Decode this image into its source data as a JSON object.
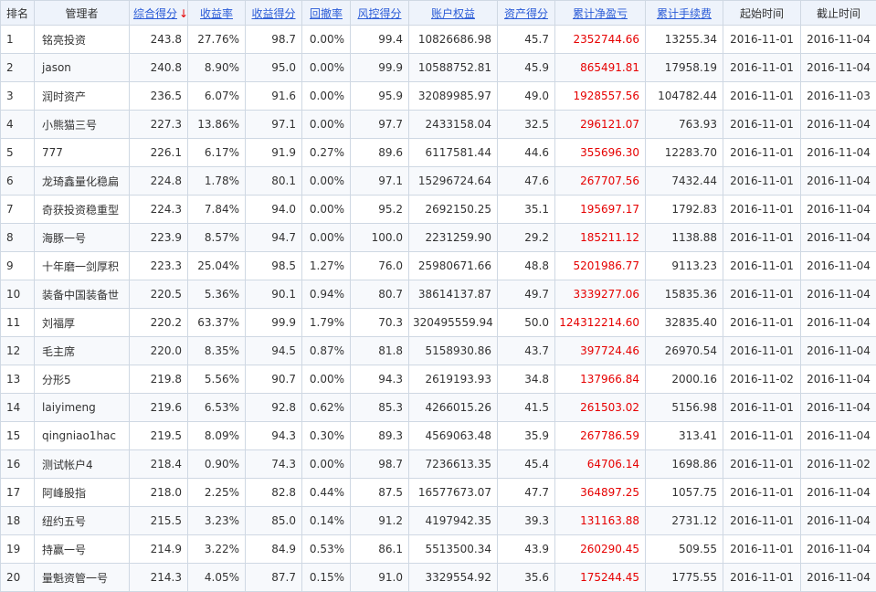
{
  "headers": [
    {
      "label": "排名",
      "sortable": false
    },
    {
      "label": "管理者",
      "sortable": false
    },
    {
      "label": "综合得分",
      "sortable": true,
      "sorted": "desc"
    },
    {
      "label": "收益率",
      "sortable": true
    },
    {
      "label": "收益得分",
      "sortable": true
    },
    {
      "label": "回撤率",
      "sortable": true
    },
    {
      "label": "风控得分",
      "sortable": true
    },
    {
      "label": "账户权益",
      "sortable": true
    },
    {
      "label": "资产得分",
      "sortable": true
    },
    {
      "label": "累计净盈亏",
      "sortable": true
    },
    {
      "label": "累计手续费",
      "sortable": true
    },
    {
      "label": "起始时间",
      "sortable": false
    },
    {
      "label": "截止时间",
      "sortable": false
    }
  ],
  "sort_arrow": "↓",
  "colors": {
    "link": "#2a5bd7",
    "profit": "#e60000",
    "header_bg": "#eef3fb",
    "border": "#cfd8e3"
  },
  "rows": [
    [
      "1",
      "铭亮投资",
      "243.8",
      "27.76%",
      "98.7",
      "0.00%",
      "99.4",
      "10826686.98",
      "45.7",
      "2352744.66",
      "13255.34",
      "2016-11-01",
      "2016-11-04"
    ],
    [
      "2",
      "jason",
      "240.8",
      "8.90%",
      "95.0",
      "0.00%",
      "99.9",
      "10588752.81",
      "45.9",
      "865491.81",
      "17958.19",
      "2016-11-01",
      "2016-11-04"
    ],
    [
      "3",
      "润时资产",
      "236.5",
      "6.07%",
      "91.6",
      "0.00%",
      "95.9",
      "32089985.97",
      "49.0",
      "1928557.56",
      "104782.44",
      "2016-11-01",
      "2016-11-03"
    ],
    [
      "4",
      "小熊猫三号",
      "227.3",
      "13.86%",
      "97.1",
      "0.00%",
      "97.7",
      "2433158.04",
      "32.5",
      "296121.07",
      "763.93",
      "2016-11-01",
      "2016-11-04"
    ],
    [
      "5",
      "777",
      "226.1",
      "6.17%",
      "91.9",
      "0.27%",
      "89.6",
      "6117581.44",
      "44.6",
      "355696.30",
      "12283.70",
      "2016-11-01",
      "2016-11-04"
    ],
    [
      "6",
      "龙琦鑫量化稳扁",
      "224.8",
      "1.78%",
      "80.1",
      "0.00%",
      "97.1",
      "15296724.64",
      "47.6",
      "267707.56",
      "7432.44",
      "2016-11-01",
      "2016-11-04"
    ],
    [
      "7",
      "奇获投资稳重型",
      "224.3",
      "7.84%",
      "94.0",
      "0.00%",
      "95.2",
      "2692150.25",
      "35.1",
      "195697.17",
      "1792.83",
      "2016-11-01",
      "2016-11-04"
    ],
    [
      "8",
      "海豚一号",
      "223.9",
      "8.57%",
      "94.7",
      "0.00%",
      "100.0",
      "2231259.90",
      "29.2",
      "185211.12",
      "1138.88",
      "2016-11-01",
      "2016-11-04"
    ],
    [
      "9",
      "十年磨一剑厚积",
      "223.3",
      "25.04%",
      "98.5",
      "1.27%",
      "76.0",
      "25980671.66",
      "48.8",
      "5201986.77",
      "9113.23",
      "2016-11-01",
      "2016-11-04"
    ],
    [
      "10",
      "装备中国装备世",
      "220.5",
      "5.36%",
      "90.1",
      "0.94%",
      "80.7",
      "38614137.87",
      "49.7",
      "3339277.06",
      "15835.36",
      "2016-11-01",
      "2016-11-04"
    ],
    [
      "11",
      "刘福厚",
      "220.2",
      "63.37%",
      "99.9",
      "1.79%",
      "70.3",
      "320495559.94",
      "50.0",
      "124312214.60",
      "32835.40",
      "2016-11-01",
      "2016-11-04"
    ],
    [
      "12",
      "毛主席",
      "220.0",
      "8.35%",
      "94.5",
      "0.87%",
      "81.8",
      "5158930.86",
      "43.7",
      "397724.46",
      "26970.54",
      "2016-11-01",
      "2016-11-04"
    ],
    [
      "13",
      "分形5",
      "219.8",
      "5.56%",
      "90.7",
      "0.00%",
      "94.3",
      "2619193.93",
      "34.8",
      "137966.84",
      "2000.16",
      "2016-11-02",
      "2016-11-04"
    ],
    [
      "14",
      "laiyimeng",
      "219.6",
      "6.53%",
      "92.8",
      "0.62%",
      "85.3",
      "4266015.26",
      "41.5",
      "261503.02",
      "5156.98",
      "2016-11-01",
      "2016-11-04"
    ],
    [
      "15",
      "qingniao1hac",
      "219.5",
      "8.09%",
      "94.3",
      "0.30%",
      "89.3",
      "4569063.48",
      "35.9",
      "267786.59",
      "313.41",
      "2016-11-01",
      "2016-11-04"
    ],
    [
      "16",
      "测试帐户4",
      "218.4",
      "0.90%",
      "74.3",
      "0.00%",
      "98.7",
      "7236613.35",
      "45.4",
      "64706.14",
      "1698.86",
      "2016-11-01",
      "2016-11-02"
    ],
    [
      "17",
      "阿峰股指",
      "218.0",
      "2.25%",
      "82.8",
      "0.44%",
      "87.5",
      "16577673.07",
      "47.7",
      "364897.25",
      "1057.75",
      "2016-11-01",
      "2016-11-04"
    ],
    [
      "18",
      "纽约五号",
      "215.5",
      "3.23%",
      "85.0",
      "0.14%",
      "91.2",
      "4197942.35",
      "39.3",
      "131163.88",
      "2731.12",
      "2016-11-01",
      "2016-11-04"
    ],
    [
      "19",
      "持赢一号",
      "214.9",
      "3.22%",
      "84.9",
      "0.53%",
      "86.1",
      "5513500.34",
      "43.9",
      "260290.45",
      "509.55",
      "2016-11-01",
      "2016-11-04"
    ],
    [
      "20",
      "量魁资管一号",
      "214.3",
      "4.05%",
      "87.7",
      "0.15%",
      "91.0",
      "3329554.92",
      "35.6",
      "175244.45",
      "1775.55",
      "2016-11-01",
      "2016-11-04"
    ]
  ]
}
